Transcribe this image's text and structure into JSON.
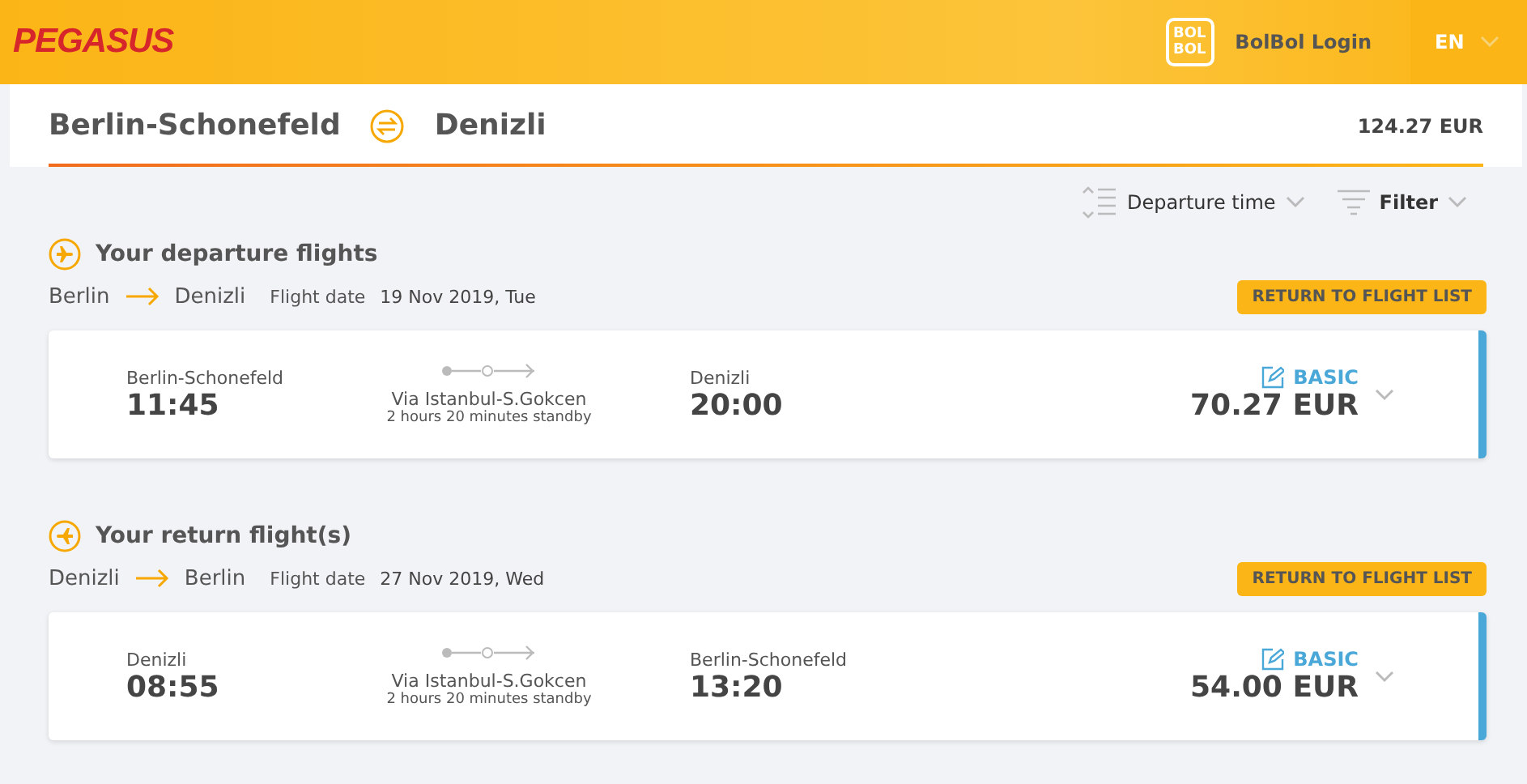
{
  "header": {
    "logo": "PEGASUS",
    "login": "BolBol Login",
    "badge_lines": [
      "BOL",
      "BOL"
    ],
    "language": "EN"
  },
  "summary": {
    "origin": "Berlin-Schonefeld",
    "destination": "Denizli",
    "total": "124.27 EUR"
  },
  "sort": {
    "label": "Departure time",
    "filter": "Filter"
  },
  "sections": [
    {
      "kind": "departure",
      "title": "Your departure flights",
      "from": "Berlin",
      "to": "Denizli",
      "date_label": "Flight date",
      "date": "19 Nov 2019, Tue",
      "button": "RETURN TO FLIGHT LIST",
      "flight": {
        "from": "Berlin-Schonefeld",
        "dep": "11:45",
        "via": "Via Istanbul-S.Gokcen",
        "standby": "2 hours 20 minutes standby",
        "to": "Denizli",
        "arr": "20:00",
        "fare": "BASIC",
        "price": "70.27 EUR"
      }
    },
    {
      "kind": "return",
      "title": "Your return flight(s)",
      "from": "Denizli",
      "to": "Berlin",
      "date_label": "Flight date",
      "date": "27 Nov 2019, Wed",
      "button": "RETURN TO FLIGHT LIST",
      "flight": {
        "from": "Denizli",
        "dep": "08:55",
        "via": "Via Istanbul-S.Gokcen",
        "standby": "2 hours 20 minutes standby",
        "to": "Berlin-Schonefeld",
        "arr": "13:20",
        "fare": "BASIC",
        "price": "54.00 EUR"
      }
    }
  ]
}
